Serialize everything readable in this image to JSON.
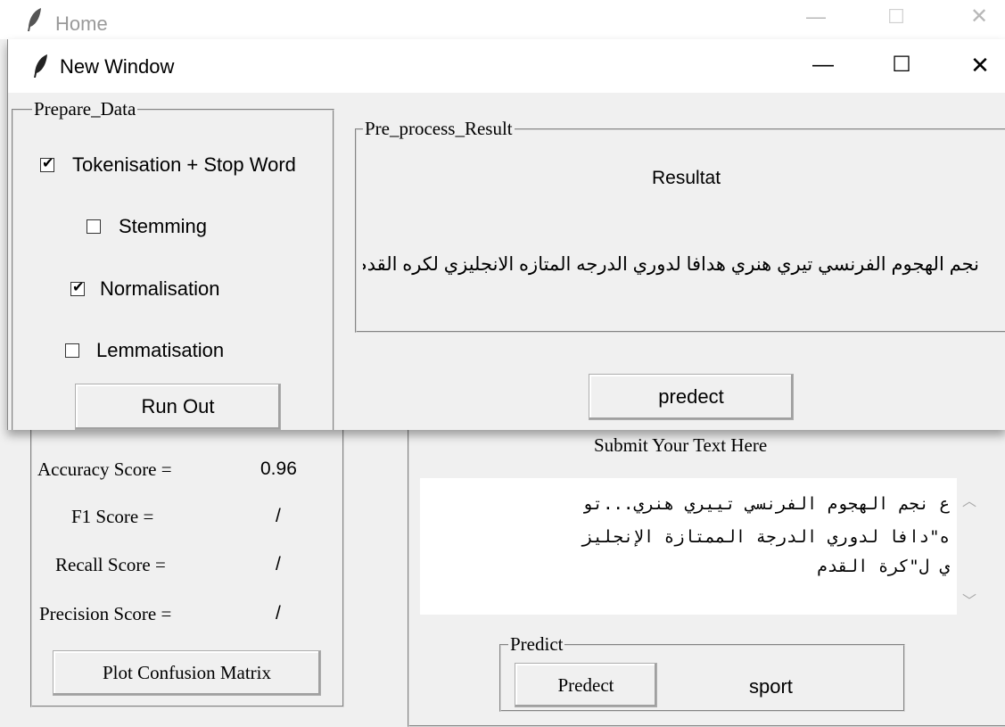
{
  "home": {
    "title": "Home",
    "scores": {
      "accuracy_label": "Accuracy Score =",
      "accuracy_value": "0.96",
      "f1_label": "F1 Score =",
      "f1_value": "/",
      "recall_label": "Recall Score =",
      "recall_value": "/",
      "precision_label": "Precision Score =",
      "precision_value": "/",
      "plot_button": "Plot Confusion Matrix"
    },
    "submit": {
      "label": "Submit Your Text Here",
      "text_line1": "ع نجم الهجوم الفرنسي تييري هنري...تو",
      "text_line2": "ه\"دافا لدوري الدرجة الممتازة الإنجليز",
      "text_line3": "ي ل\"كرة القدم"
    },
    "predict": {
      "legend": "Predict",
      "button": "Predect",
      "result": "sport"
    }
  },
  "new_window": {
    "title": "New Window",
    "prepare": {
      "legend": "Prepare_Data",
      "tokenisation_label": "Tokenisation + Stop Word",
      "tokenisation_checked": true,
      "stemming_label": "Stemming",
      "stemming_checked": false,
      "normalisation_label": "Normalisation",
      "normalisation_checked": true,
      "lemmatisation_label": "Lemmatisation",
      "lemmatisation_checked": false,
      "run_button": "Run Out"
    },
    "preprocess": {
      "legend": "Pre_process_Result",
      "heading": "Resultat",
      "result_text": "نجم الهجوم الفرنسي تيري هنري هدافا لدوري الدرجه المتازه الانجليزي لكره القدم",
      "predict_button": "predect"
    }
  },
  "window_buttons": {
    "minimize": "—",
    "maximize": "☐",
    "close": "✕"
  }
}
